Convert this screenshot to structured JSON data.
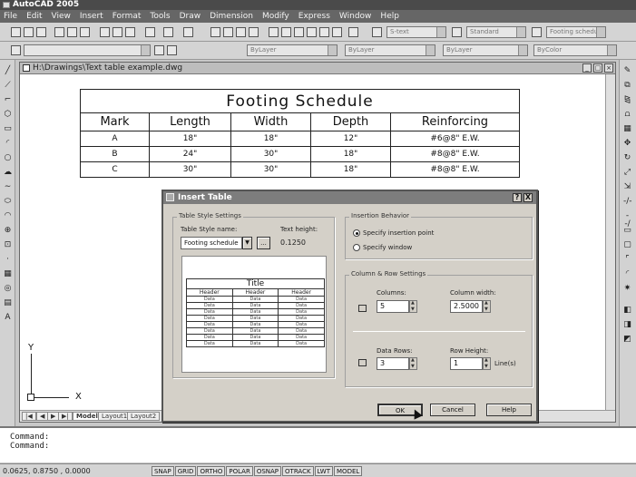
{
  "app": {
    "title": "AutoCAD 2005"
  },
  "menu": [
    "File",
    "Edit",
    "View",
    "Insert",
    "Format",
    "Tools",
    "Draw",
    "Dimension",
    "Modify",
    "Express",
    "Window",
    "Help"
  ],
  "toolbar": {
    "text_style": "S-text",
    "dim_style": "Standard",
    "table_style": "Footing schedul",
    "layer": "ByLayer",
    "linetype": "ByLayer",
    "lineweight": "ByLayer",
    "plotstyle": "ByColor"
  },
  "drawing": {
    "title": "H:\\Drawings\\Text table example.dwg",
    "tabs": [
      "Model",
      "Layout1",
      "Layout2"
    ]
  },
  "footing_table": {
    "title": "Footing Schedule",
    "headers": [
      "Mark",
      "Length",
      "Width",
      "Depth",
      "Reinforcing"
    ],
    "rows": [
      [
        "A",
        "18\"",
        "18\"",
        "12\"",
        "#6@8\" E.W."
      ],
      [
        "B",
        "24\"",
        "30\"",
        "18\"",
        "#8@8\" E.W."
      ],
      [
        "C",
        "30\"",
        "30\"",
        "18\"",
        "#8@8\" E.W."
      ]
    ]
  },
  "ucs": {
    "y": "Y",
    "x": "X"
  },
  "command": {
    "lines": [
      "Command:",
      "Command:"
    ]
  },
  "status": {
    "coords": "0.0625, 0.8750 , 0.0000",
    "buttons": [
      "SNAP",
      "GRID",
      "ORTHO",
      "POLAR",
      "OSNAP",
      "OTRACK",
      "LWT",
      "MODEL"
    ]
  },
  "dialog": {
    "title": "Insert Table",
    "help_btn": "?",
    "close_btn": "X",
    "style_group": "Table Style Settings",
    "style_name_label": "Table Style name:",
    "style_name": "Footing schedule",
    "browse": "...",
    "text_height_label": "Text height:",
    "text_height": "0.1250",
    "preview": {
      "title": "Title",
      "header": "Header",
      "data": "Data"
    },
    "insertion_group": "Insertion Behavior",
    "opt_point": "Specify insertion point",
    "opt_window": "Specify window",
    "colrow_group": "Column & Row Settings",
    "columns_label": "Columns:",
    "columns": "5",
    "colwidth_label": "Column width:",
    "colwidth": "2.5000",
    "datarows_label": "Data Rows:",
    "datarows": "3",
    "rowheight_label": "Row Height:",
    "rowheight": "1",
    "lines": "Line(s)",
    "ok": "OK",
    "cancel": "Cancel",
    "help": "Help"
  }
}
